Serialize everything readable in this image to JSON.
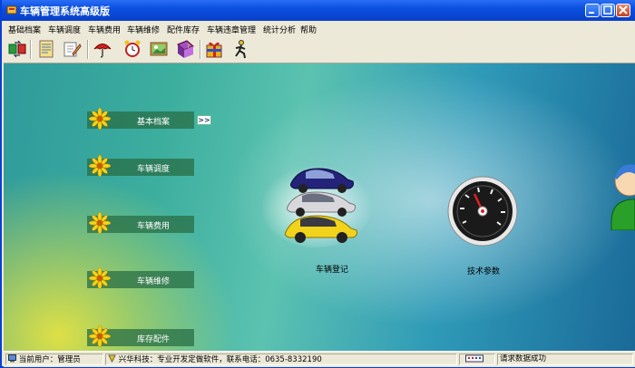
{
  "window": {
    "title": "车辆管理系统高级版"
  },
  "menu": [
    "基础档案",
    "车辆调度",
    "车辆费用",
    "车辆维修",
    "配件库存",
    "车辆违章管理",
    "统计分析",
    "帮助"
  ],
  "toolbar": {
    "icons": [
      "transfer-icon",
      "notes-icon",
      "edit-icon",
      "umbrella-icon",
      "alarm-clock-icon",
      "picture-icon",
      "help-book-icon",
      "gift-box-icon",
      "running-man-icon"
    ]
  },
  "nav": {
    "items": [
      {
        "label": "基本档案"
      },
      {
        "label": "车辆调度"
      },
      {
        "label": "车辆费用"
      },
      {
        "label": "车辆维修"
      },
      {
        "label": "库存配件"
      }
    ],
    "expand_label": ">>"
  },
  "center": {
    "vehicle_label": "车辆登记",
    "params_label": "技术参数"
  },
  "status": {
    "user": "当前用户：管理员",
    "company": "兴华科技：专业开发定做软件，联系电话：0635-8332190",
    "message": "请求数据成功"
  }
}
